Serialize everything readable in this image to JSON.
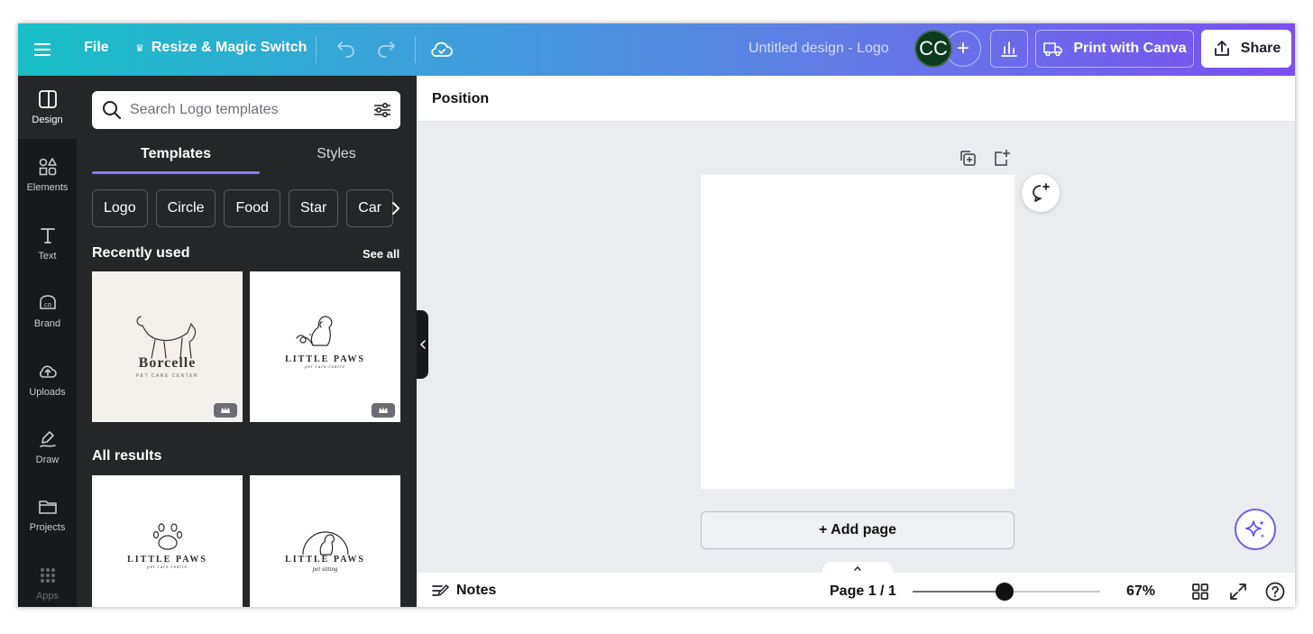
{
  "topbar": {
    "file": "File",
    "resize": "Resize & Magic Switch",
    "title": "Untitled design - Logo",
    "avatar_initials": "CC",
    "add": "+",
    "print": "Print with Canva",
    "share": "Share"
  },
  "rail": [
    {
      "label": "Design",
      "icon": "design-icon"
    },
    {
      "label": "Elements",
      "icon": "elements-icon"
    },
    {
      "label": "Text",
      "icon": "text-icon"
    },
    {
      "label": "Brand",
      "icon": "brand-icon"
    },
    {
      "label": "Uploads",
      "icon": "uploads-icon"
    },
    {
      "label": "Draw",
      "icon": "draw-icon"
    },
    {
      "label": "Projects",
      "icon": "projects-icon"
    },
    {
      "label": "Apps",
      "icon": "apps-icon"
    }
  ],
  "panel": {
    "search_placeholder": "Search Logo templates",
    "tabs": [
      "Templates",
      "Styles"
    ],
    "chips": [
      "Logo",
      "Circle",
      "Food",
      "Star",
      "Car"
    ],
    "recently_used": "Recently used",
    "see_all": "See all",
    "all_results": "All results",
    "thumbs": [
      {
        "title": "Borcelle",
        "subtitle": "PET CARE CENTER"
      },
      {
        "title": "LITTLE PAWS",
        "subtitle": "pet care centre"
      },
      {
        "title": "LITTLE PAWS",
        "subtitle": "pet care centre"
      },
      {
        "title": "LITTLE PAWS",
        "subtitle": "pet sitting"
      }
    ]
  },
  "editor": {
    "position": "Position",
    "add_page": "+ Add page"
  },
  "footer": {
    "notes": "Notes",
    "page_count": "Page 1 / 1",
    "zoom": "67%",
    "zoom_level": 0.49
  },
  "colors": {
    "accent": "#8b7cf6",
    "panel": "#252627",
    "rail": "#18191b",
    "avatar": "#0a3b1f"
  }
}
